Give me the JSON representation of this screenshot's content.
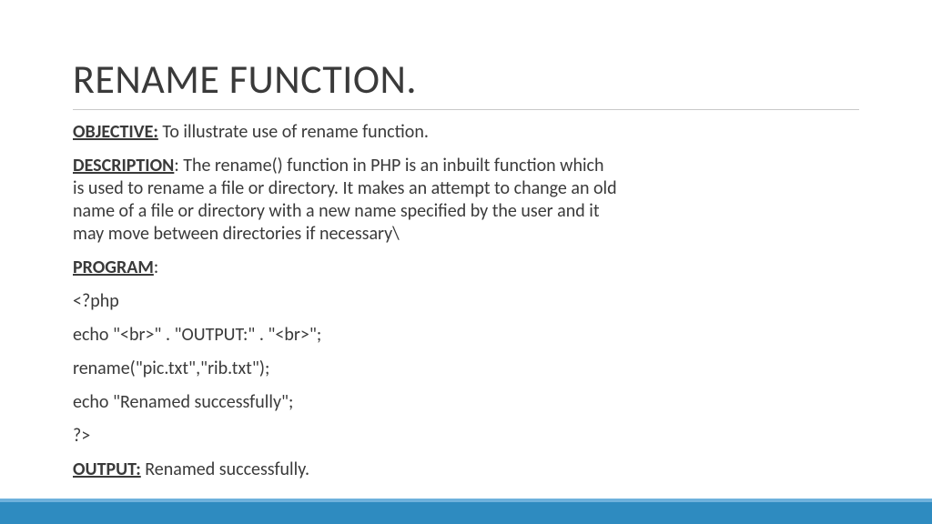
{
  "title": "RENAME FUNCTION.",
  "objective": {
    "label": "OBJECTIVE:",
    "text": " To illustrate use of rename function."
  },
  "description": {
    "label": "DESCRIPTION",
    "text": ": The rename() function in PHP is an inbuilt function which is used to rename a file or directory. It makes an attempt to change an old name of a file or directory with a new name specified by the user and it may move between directories if necessary\\"
  },
  "program": {
    "label": "PROGRAM",
    "colon": ":",
    "lines": [
      " <?php",
      "echo \"<br>\" . \"OUTPUT:\" . \"<br>\";",
      "rename(\"pic.txt\",\"rib.txt\");",
      "echo \"Renamed successfully\";",
      "?>"
    ]
  },
  "output": {
    "label": "OUTPUT:",
    "text": " Renamed successfully."
  }
}
